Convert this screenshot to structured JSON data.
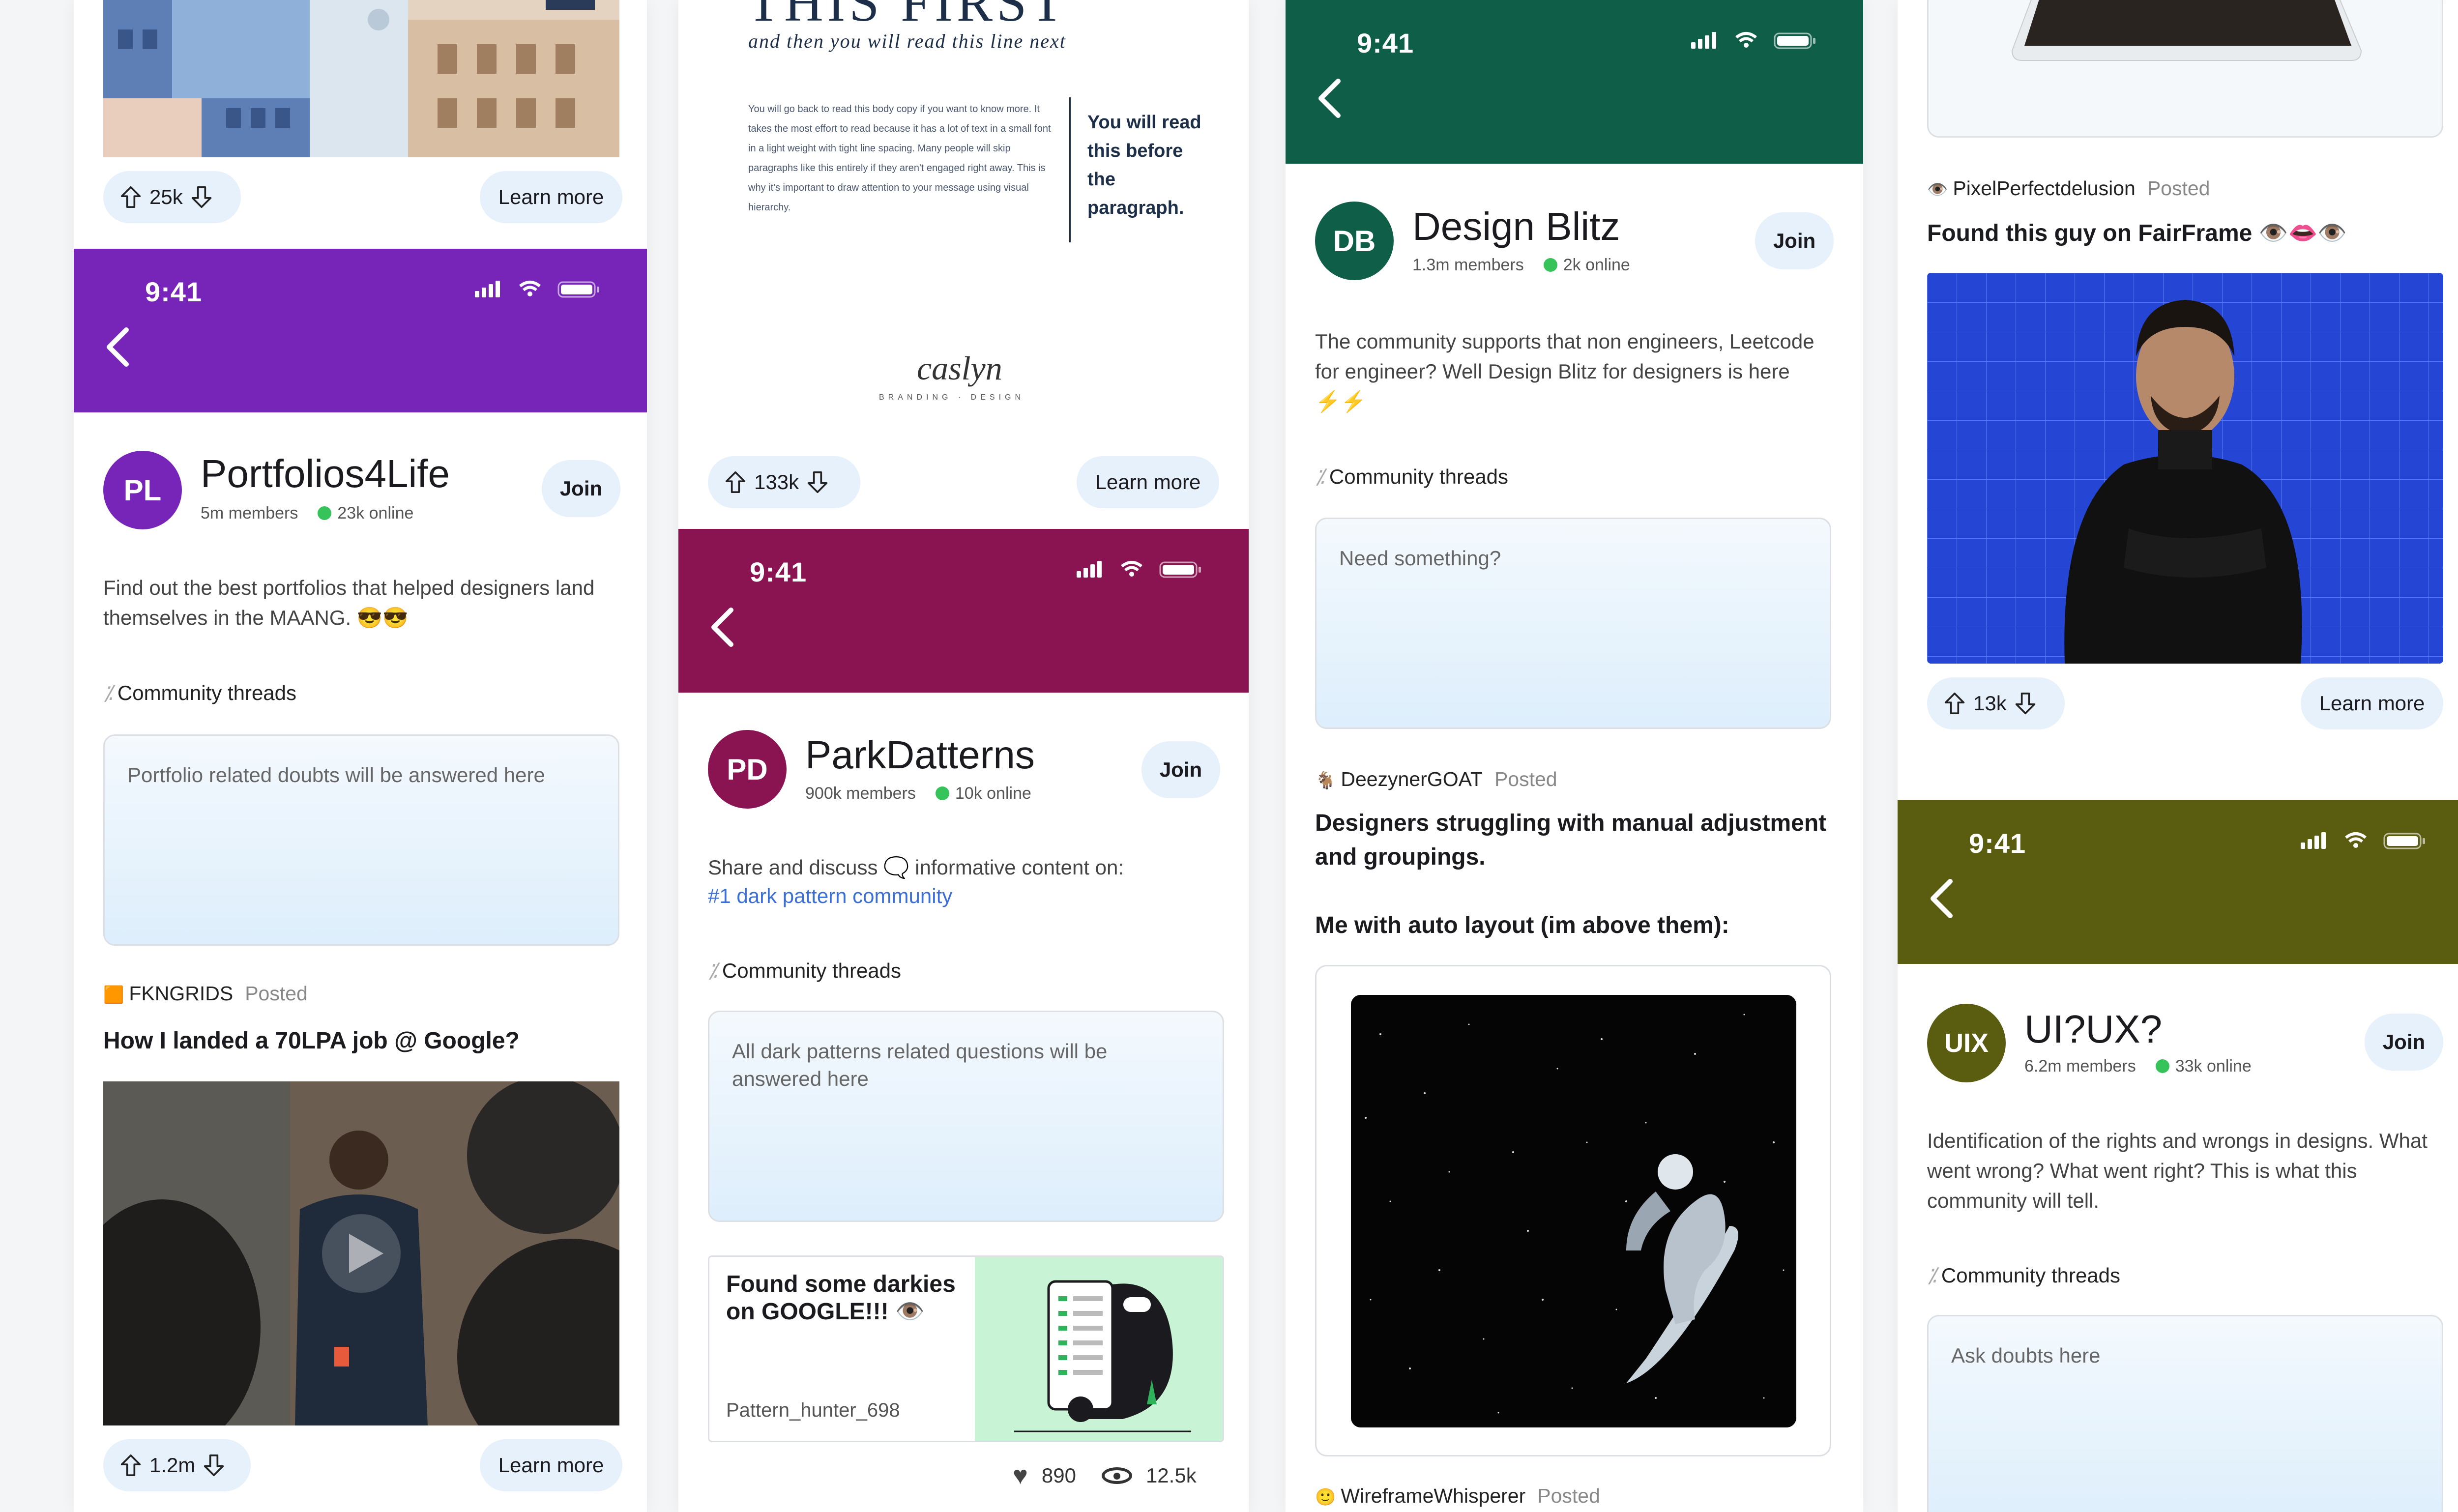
{
  "col1": {
    "top_votes": "25k",
    "top_learn": "Learn more",
    "time": "9:41",
    "avatar": "PL",
    "name": "Portfolios4Life",
    "members": "5m members",
    "online": "23k online",
    "join": "Join",
    "desc": "Find out the best portfolios that helped designers land themselves in the MAANG. 😎😎",
    "threads": "Community threads",
    "input_placeholder": "Portfolio related doubts will be answered here",
    "author": "FKNGRIDS",
    "posted": "Posted",
    "post_title": "How I landed a 70LPA job @ Google?",
    "bottom_votes": "1.2m",
    "bottom_learn": "Learn more",
    "accent": "#7724b9"
  },
  "col2": {
    "poster_heading": "and then you will read this line next",
    "poster_body": "You will go back to read this body copy if you want to know more. It takes the most effort to read because it has a lot of text in a small font in a light weight with tight line spacing. Many people will skip paragraphs like this entirely if they aren't engaged right away. This is why it's important to draw attention to your message using visual hierarchy.",
    "poster_callout": "You will read this before the paragraph.",
    "poster_logo": "caslyn",
    "poster_logo_sub": "BRANDING · DESIGN",
    "top_votes": "133k",
    "top_learn": "Learn more",
    "time": "9:41",
    "avatar": "PD",
    "name": "ParkDatterns",
    "members": "900k members",
    "online": "10k online",
    "join": "Join",
    "desc_prefix": "Share and discuss 🗨️ informative content on:",
    "desc_link": "#1 dark pattern community",
    "threads": "Community threads",
    "input_placeholder": "All dark patterns related questions will be answered here",
    "card_title": "Found some darkies on GOOGLE!!! 👁️",
    "card_author": "Pattern_hunter_698",
    "likes": "890",
    "views": "12.5k",
    "accent": "#8a1452"
  },
  "col3": {
    "time": "9:41",
    "avatar": "DB",
    "name": "Design Blitz",
    "members": "1.3m members",
    "online": "2k online",
    "join": "Join",
    "desc": "The community supports that non engineers, Leetcode for engineer? Well Design Blitz for designers is here ⚡⚡",
    "threads": "Community threads",
    "input_placeholder": "Need something?",
    "author": "DeezynerGOAT",
    "posted": "Posted",
    "post_title": "Designers struggling with manual adjustment and groupings.",
    "post_sub": "Me with auto layout (im above them):",
    "bottom_author": "WireframeWhisperer",
    "bottom_posted": "Posted",
    "accent": "#0f5e48"
  },
  "col4": {
    "author": "PixelPerfectdelusion",
    "posted": "Posted",
    "post_title": "Found this guy on FairFrame 👁️👄👁️",
    "votes": "13k",
    "learn": "Learn more",
    "time": "9:41",
    "avatar": "UIX",
    "name": "UI?UX?",
    "members": "6.2m members",
    "online": "33k online",
    "join": "Join",
    "desc": "Identification of the rights and wrongs in designs. What went wrong? What went right? This is what this community will tell.",
    "threads": "Community threads",
    "input_placeholder": "Ask doubts here",
    "accent": "#5a5c0f"
  }
}
